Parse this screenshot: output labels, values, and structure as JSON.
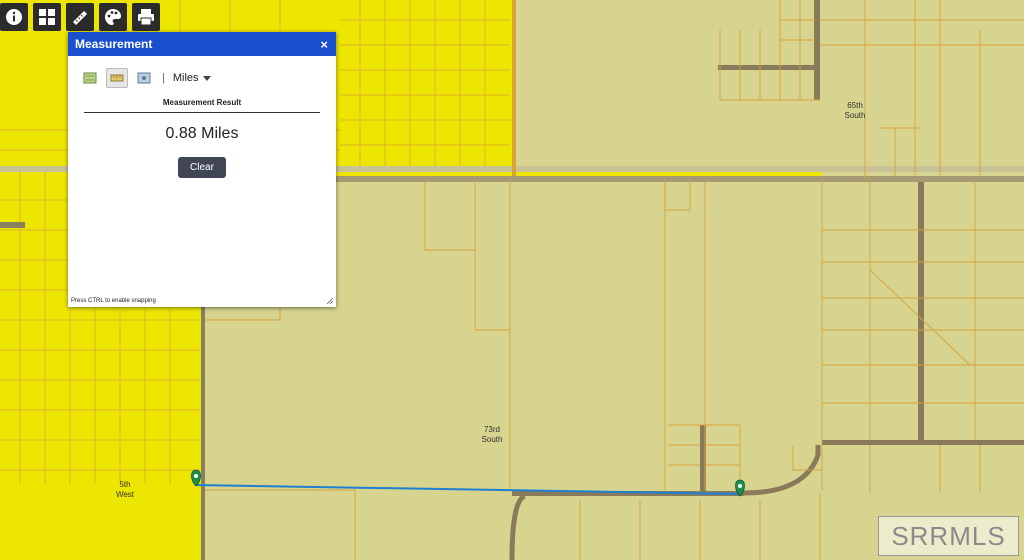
{
  "toolbar": {
    "items": [
      {
        "name": "info-icon"
      },
      {
        "name": "grid-icon"
      },
      {
        "name": "ruler-icon"
      },
      {
        "name": "palette-icon"
      },
      {
        "name": "printer-icon"
      }
    ]
  },
  "measurement": {
    "title": "Measurement",
    "close_label": "×",
    "tools": [
      "area-tool-icon",
      "distance-tool-icon",
      "location-tool-icon"
    ],
    "active_tool": "distance-tool-icon",
    "separator": "|",
    "unit": "Miles",
    "result_label": "Measurement Result",
    "result_value": "0.88 Miles",
    "clear_label": "Clear",
    "snap_hint": "Press CTRL to enable snapping"
  },
  "map": {
    "labels": [
      {
        "id": "label-65th-south",
        "line1": "65th",
        "line2": "South"
      },
      {
        "id": "label-73rd-south",
        "line1": "73rd",
        "line2": "South"
      },
      {
        "id": "label-5th-west",
        "line1": "5th",
        "line2": "West"
      }
    ],
    "zoning_color": "#ece600",
    "land_color": "#d6d48f",
    "parcel_line_color": "#d9a23a",
    "measure_line_color": "#1f7fd1",
    "marker_color": "#1c8f4a"
  },
  "watermark": "SRRMLS"
}
